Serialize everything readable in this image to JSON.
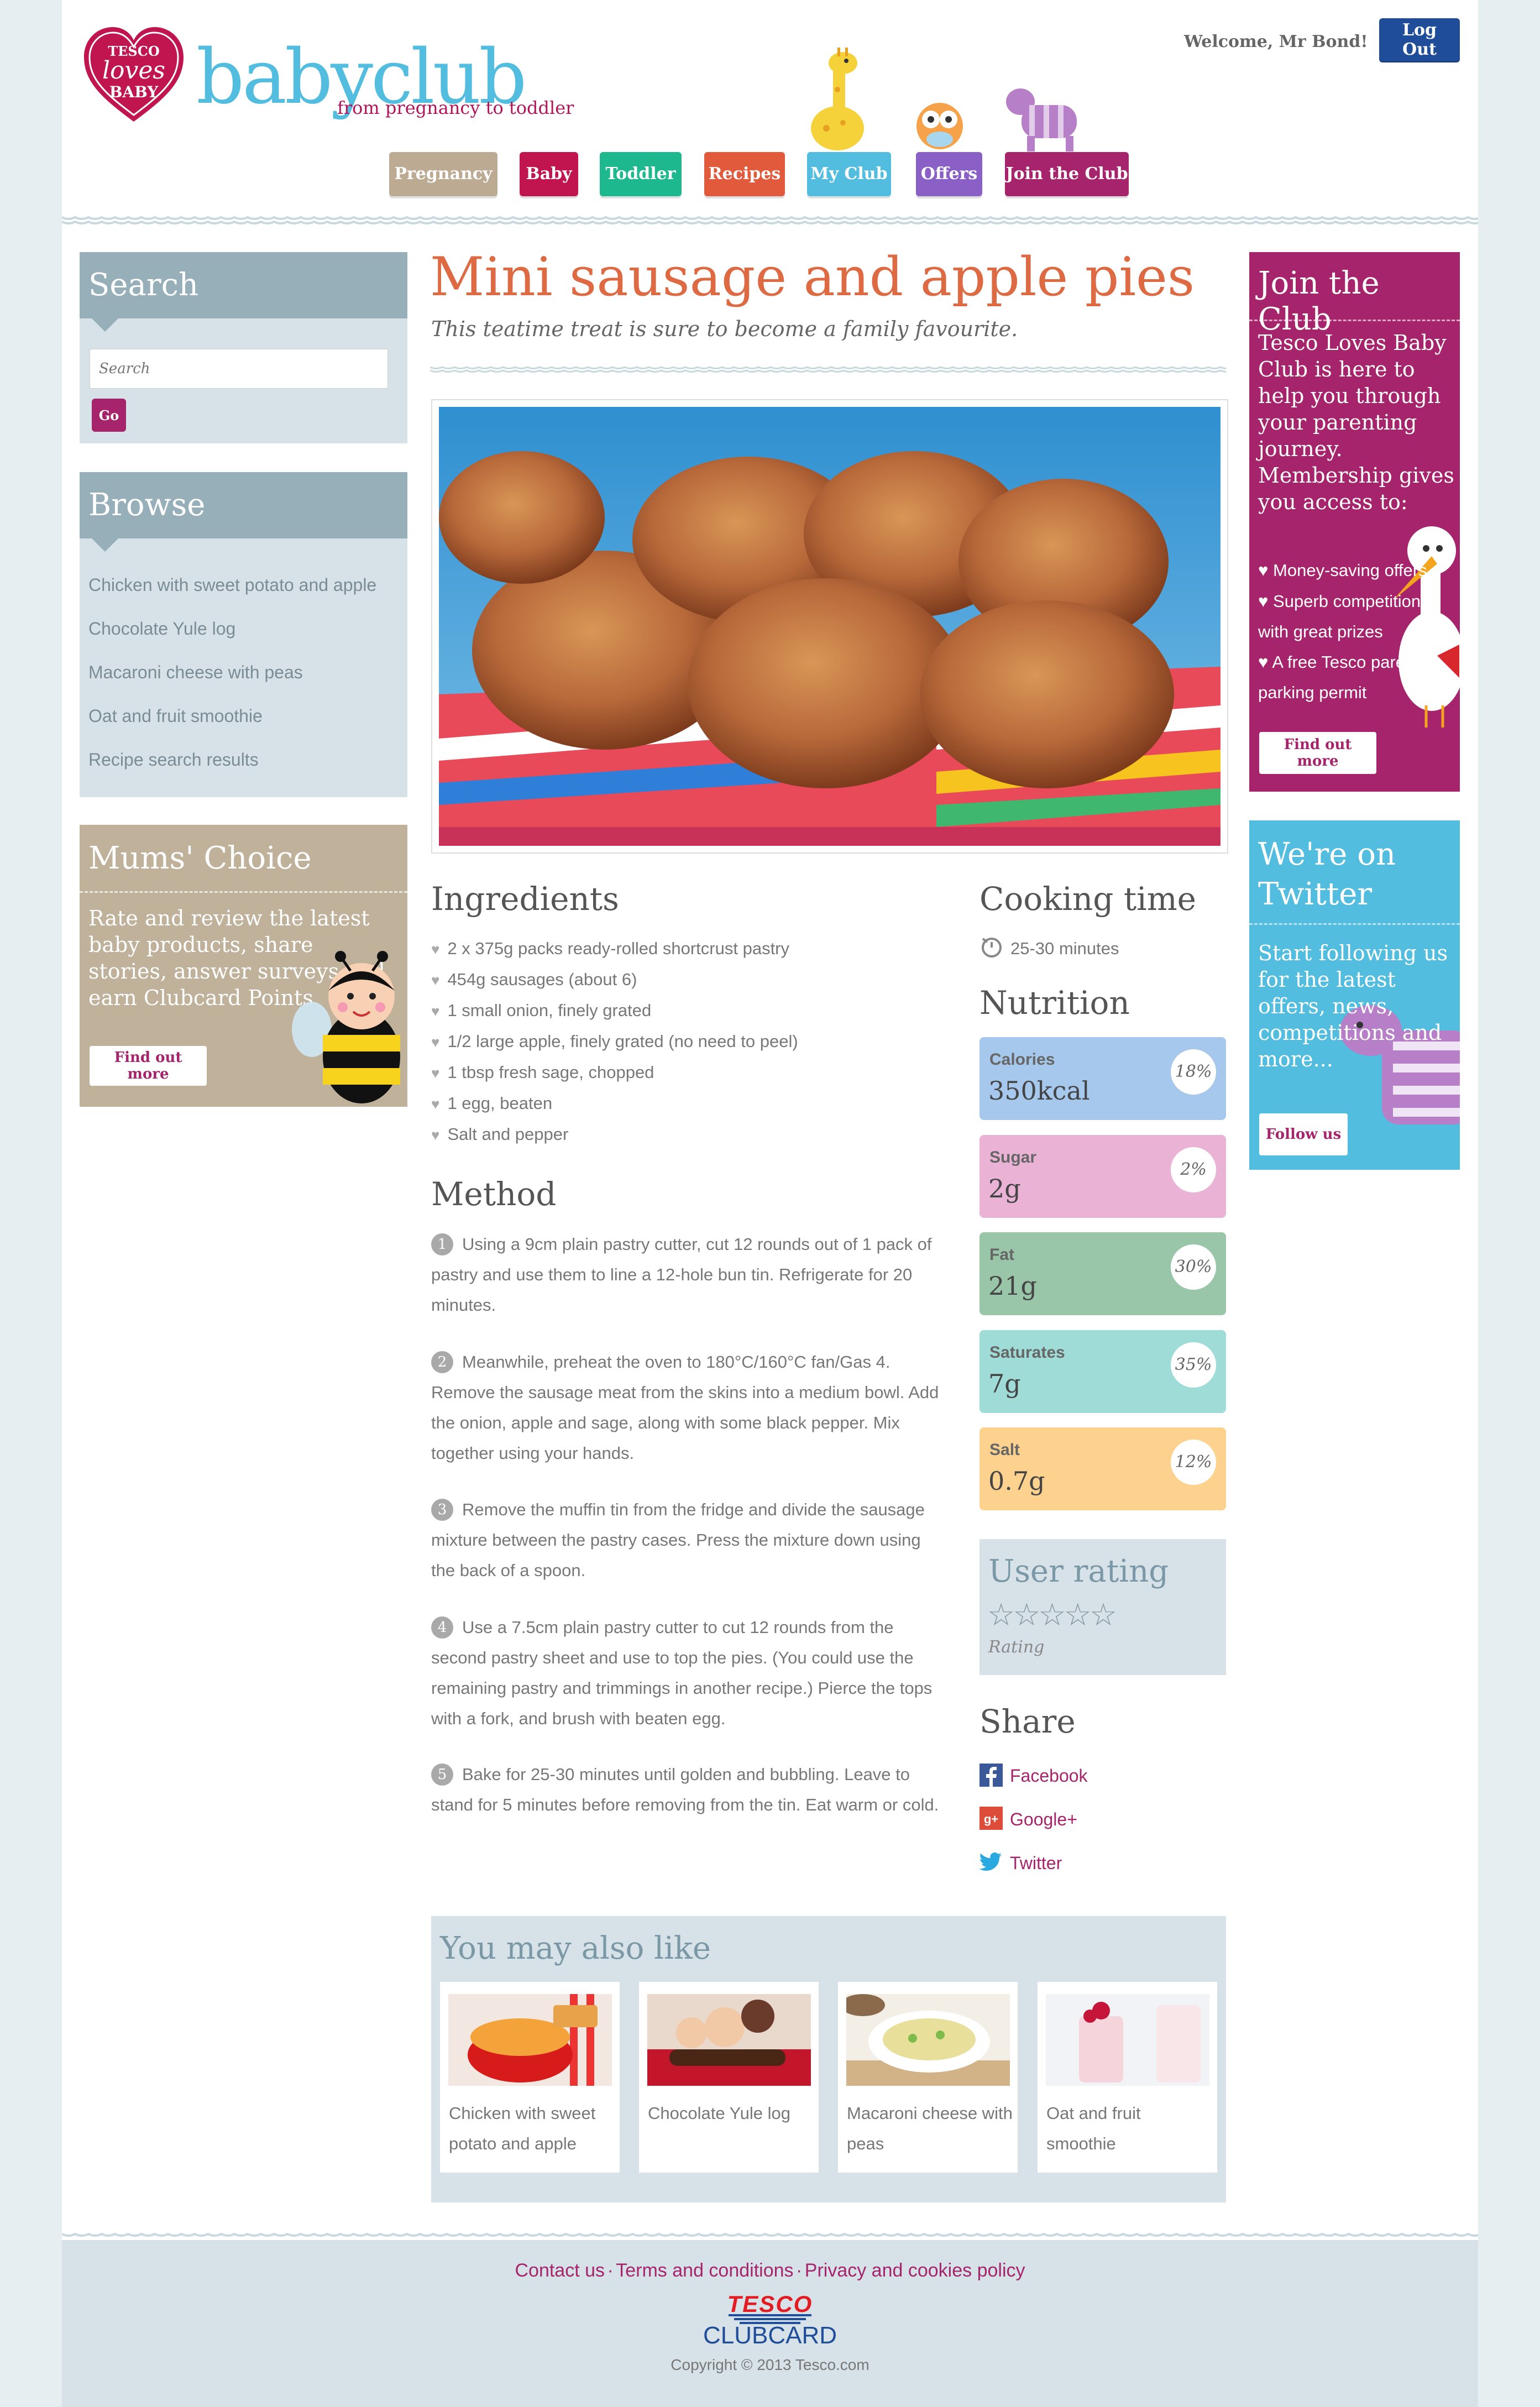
{
  "header": {
    "logo_top": "TESCO",
    "logo_mid": "loves",
    "logo_bottom": "BABY",
    "brand": "babyclub",
    "tagline": "from pregnancy to toddler",
    "welcome": "Welcome, Mr Bond!",
    "logout_label": "Log Out"
  },
  "nav": {
    "items": [
      {
        "label": "Pregnancy",
        "color": "#bcaa93"
      },
      {
        "label": "Baby",
        "color": "#c0154f"
      },
      {
        "label": "Toddler",
        "color": "#1eb88f"
      },
      {
        "label": "Recipes",
        "color": "#e15a3b"
      },
      {
        "label": "My Club",
        "color": "#52bddf"
      },
      {
        "label": "Offers",
        "color": "#8a60c6"
      },
      {
        "label": "Join the Club",
        "color": "#a6246b"
      }
    ]
  },
  "search": {
    "heading": "Search",
    "placeholder": "Search",
    "go_label": "Go"
  },
  "browse": {
    "heading": "Browse",
    "links": [
      "Chicken with sweet potato and apple",
      "Chocolate Yule log",
      "Macaroni cheese with peas",
      "Oat and fruit smoothie",
      "Recipe search results"
    ]
  },
  "mums_choice": {
    "heading": "Mums' Choice",
    "body": "Rate and review the latest baby products, share stories, answer surveys and earn Clubcard Points",
    "button": "Find out more"
  },
  "recipe": {
    "title": "Mini sausage and apple pies",
    "subtitle": "This teatime treat is sure to become a family favourite.",
    "ingredients_heading": "Ingredients",
    "ingredients": [
      "2 x 375g packs ready-rolled shortcrust pastry",
      "454g sausages (about 6)",
      "1 small onion, finely grated",
      "1/2 large apple, finely grated (no need to peel)",
      "1 tbsp fresh sage, chopped",
      "1 egg, beaten",
      "Salt and pepper"
    ],
    "method_heading": "Method",
    "steps": [
      {
        "num": "1",
        "text": "Using a 9cm plain pastry cutter, cut 12 rounds out of 1 pack of pastry and use them to line a 12-hole bun tin. Refrigerate for 20 minutes."
      },
      {
        "num": "2",
        "text": "Meanwhile, preheat the oven to 180°C/160°C fan/Gas 4. Remove the sausage meat from the skins into a medium bowl. Add the onion, apple and sage, along with some black pepper. Mix together using your hands."
      },
      {
        "num": "3",
        "text": "Remove the muffin tin from the fridge and divide the sausage mixture between the pastry cases. Press the mixture down using the back of a spoon."
      },
      {
        "num": "4",
        "text": "Use a 7.5cm plain pastry cutter to cut 12 rounds from the second pastry sheet and use to top the pies. (You could use the remaining pastry and trimmings in another recipe.) Pierce the tops with a fork, and brush with beaten egg."
      },
      {
        "num": "5",
        "text": "Bake for 25-30 minutes until golden and bubbling. Leave to stand for 5 minutes before removing from the tin. Eat warm or cold."
      }
    ]
  },
  "cooking": {
    "heading": "Cooking time",
    "time": "25-30 minutes"
  },
  "nutrition": {
    "heading": "Nutrition",
    "items": [
      {
        "label": "Calories",
        "value": "350kcal",
        "pct": "18%",
        "color": "#a6c8ec"
      },
      {
        "label": "Sugar",
        "value": "2g",
        "pct": "2%",
        "color": "#eab3d5"
      },
      {
        "label": "Fat",
        "value": "21g",
        "pct": "30%",
        "color": "#99c5a8"
      },
      {
        "label": "Saturates",
        "value": "7g",
        "pct": "35%",
        "color": "#9fdcd8"
      },
      {
        "label": "Salt",
        "value": "0.7g",
        "pct": "12%",
        "color": "#fdd18e"
      }
    ]
  },
  "rating": {
    "heading": "User rating",
    "stars": "☆☆☆☆☆",
    "label": "Rating"
  },
  "share": {
    "heading": "Share",
    "links": [
      "Facebook",
      "Google+",
      "Twitter"
    ]
  },
  "related": {
    "heading": "You may also like",
    "items": [
      "Chicken with sweet potato and apple",
      "Chocolate Yule log",
      "Macaroni cheese with peas",
      "Oat and fruit smoothie"
    ]
  },
  "join": {
    "heading": "Join the Club",
    "body": "Tesco Loves Baby Club is here to help you through your parenting journey. Membership gives you access to:",
    "bullets": [
      "Money-saving offers",
      "Superb competitions with great prizes",
      "A free Tesco parents parking permit"
    ],
    "button": "Find out more"
  },
  "twitter": {
    "heading": "We're on Twitter",
    "body": "Start following us for the latest offers, news, competitions and more...",
    "button": "Follow us"
  },
  "footer": {
    "links": [
      "Contact us",
      "Terms and conditions",
      "Privacy and cookies policy"
    ],
    "separator": "·",
    "brand_top": "TESCO",
    "brand_bottom": "CLUBCARD",
    "copyright": "Copyright © 2013 Tesco.com"
  }
}
